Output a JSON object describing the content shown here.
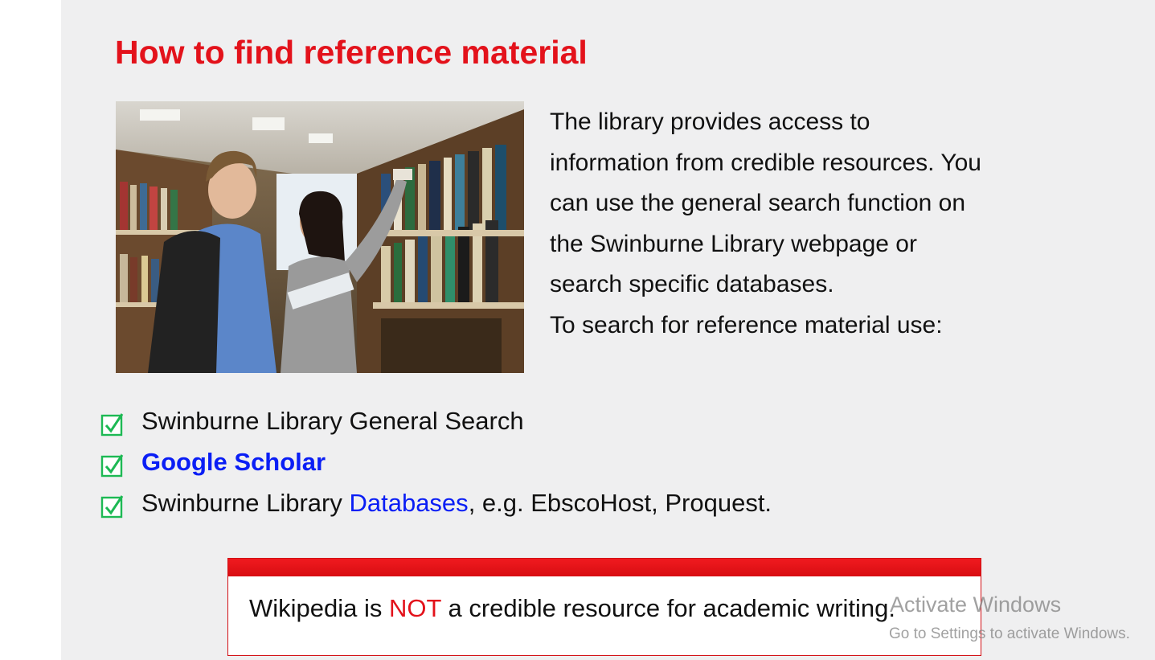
{
  "slide": {
    "title": "How to find reference material",
    "intro_lines": [
      "The library provides access to",
      "information from credible resources.  You",
      "can use the general search function on",
      "the Swinburne Library webpage or",
      "search specific databases.",
      "To search for reference material use:"
    ],
    "checklist": [
      {
        "text": "Swinburne Library General Search"
      },
      {
        "link": "Google Scholar"
      },
      {
        "prefix": "Swinburne Library ",
        "link": "Databases",
        "suffix": ", e.g. EbscoHost, Proquest."
      }
    ],
    "notice": {
      "before": "Wikipedia is ",
      "emphasis": "NOT",
      "after": " a credible resource for academic writing."
    }
  },
  "watermark": {
    "title": "Activate Windows",
    "subtitle": "Go to Settings to activate Windows."
  },
  "colors": {
    "title_red": "#e3121b",
    "link_blue": "#0a1ef5",
    "check_green": "#1db954",
    "slide_bg": "#efeff0"
  },
  "icons": [
    "checkbox-checked-icon"
  ]
}
